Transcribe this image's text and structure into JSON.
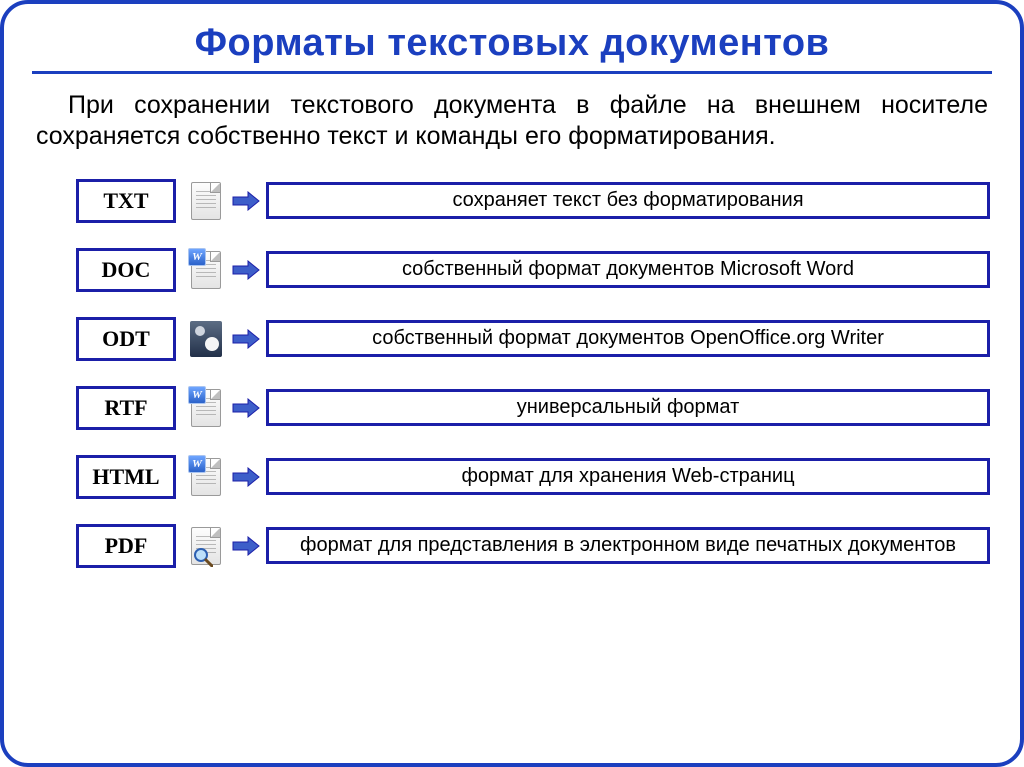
{
  "title": "Форматы текстовых документов",
  "intro": "При сохранении текстового документа в файле на внешнем носителе сохраняется собственно текст и команды его форматирования.",
  "formats": [
    {
      "label": "TXT",
      "icon": "text-file-icon",
      "desc": "сохраняет текст без форматирования"
    },
    {
      "label": "DOC",
      "icon": "word-file-icon",
      "desc": "собственный формат документов Microsoft Word"
    },
    {
      "label": "ODT",
      "icon": "openoffice-file-icon",
      "desc": "собственный формат документов OpenOffice.org Writer"
    },
    {
      "label": "RTF",
      "icon": "word-file-icon",
      "desc": "универсальный формат"
    },
    {
      "label": "HTML",
      "icon": "word-file-icon",
      "desc": "формат для хранения Web-страниц"
    },
    {
      "label": "PDF",
      "icon": "pdf-magnifier-icon",
      "desc": "формат для представления в электронном виде печатных документов"
    }
  ],
  "colors": {
    "border": "#1b3fbf",
    "box_border": "#1b1fa8",
    "arrow_fill": "#3d5ec9"
  }
}
